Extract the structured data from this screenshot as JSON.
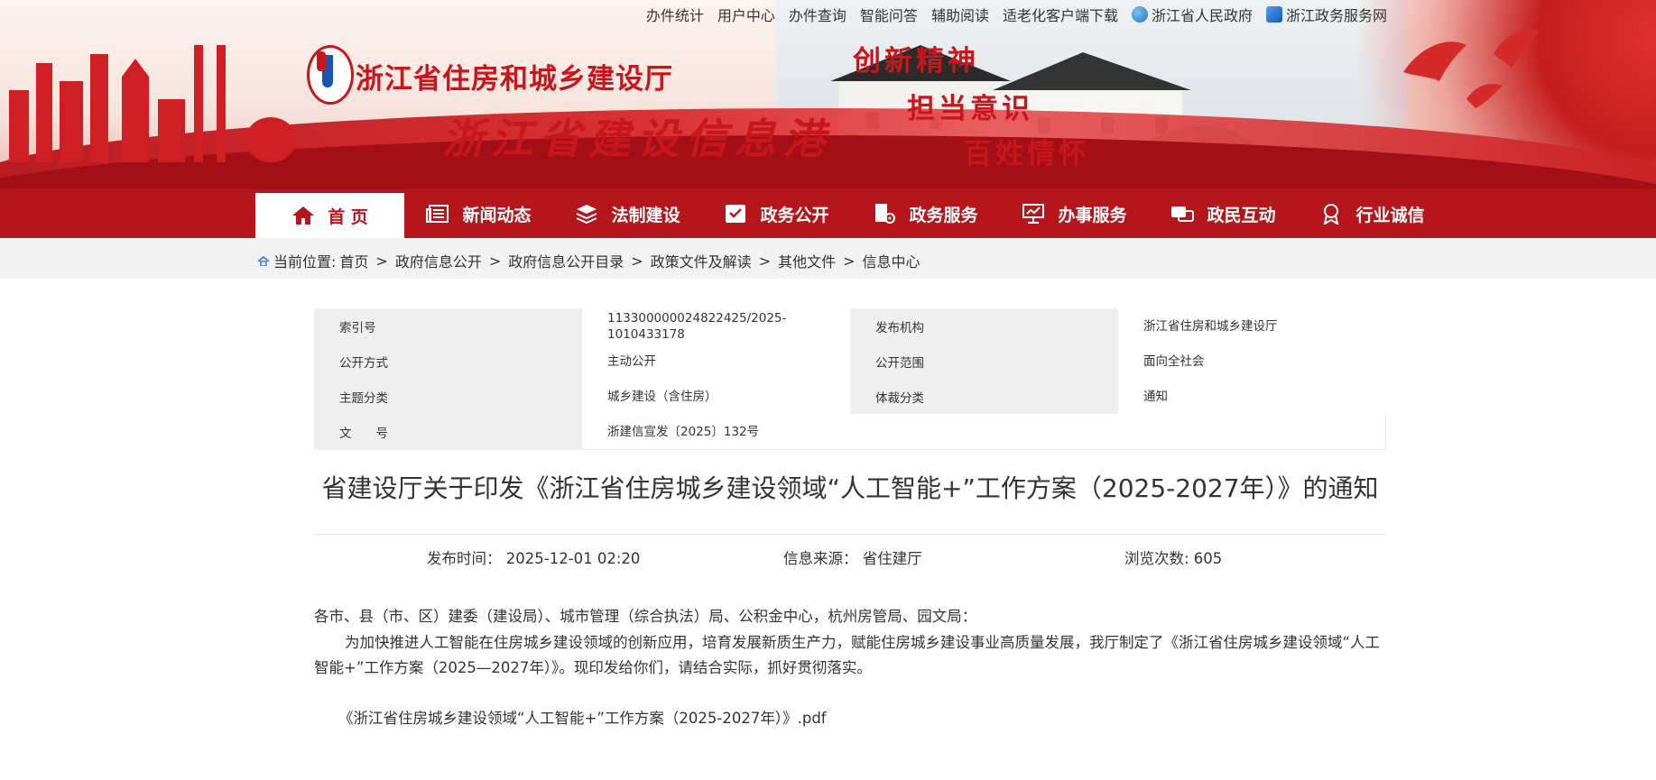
{
  "top_links": [
    "办件统计",
    "用户中心",
    "办件查询",
    "智能问答",
    "辅助阅读",
    "适老化客户端下载"
  ],
  "gov_links": [
    "浙江省人民政府",
    "浙江政务服务网"
  ],
  "banner": {
    "logo_text": "浙江省住房和城乡建设厅",
    "portal_title": "浙江省建设信息港",
    "slogans": [
      "创新精神",
      "担当意识",
      "百姓情怀"
    ]
  },
  "nav": {
    "items": [
      {
        "label": "首 页",
        "icon": "home-icon"
      },
      {
        "label": "新闻动态",
        "icon": "news-icon"
      },
      {
        "label": "法制建设",
        "icon": "layers-icon"
      },
      {
        "label": "政务公开",
        "icon": "checklist-icon"
      },
      {
        "label": "政务服务",
        "icon": "document-gear-icon"
      },
      {
        "label": "办事服务",
        "icon": "presentation-icon"
      },
      {
        "label": "政民互动",
        "icon": "chat-icon"
      },
      {
        "label": "行业诚信",
        "icon": "badge-icon"
      }
    ],
    "active": "首 页"
  },
  "breadcrumb": {
    "prefix": "当前位置:",
    "items": [
      "首页",
      "政府信息公开",
      "政府信息公开目录",
      "政策文件及解读",
      "其他文件",
      "信息中心"
    ]
  },
  "info": {
    "rows": [
      {
        "l1": "索引号",
        "v1": "113300000024822425/2025-1010433178",
        "l2": "发布机构",
        "v2": "浙江省住房和城乡建设厅"
      },
      {
        "l1": "公开方式",
        "v1": "主动公开",
        "l2": "公开范围",
        "v2": "面向全社会"
      },
      {
        "l1": "主题分类",
        "v1": "城乡建设（含住房）",
        "l2": "体裁分类",
        "v2": "通知"
      },
      {
        "l1": "文　　号",
        "v1": "浙建信宣发〔2025〕132号"
      }
    ]
  },
  "article": {
    "title": "省建设厅关于印发《浙江省住房城乡建设领域“人工智能+”工作方案（2025-2027年）》的通知",
    "publish_time": "发布时间：  2025-12-01 02:20",
    "source": "信息来源：  省住建厅",
    "views": "浏览次数: 605",
    "para1": "各市、县（市、区）建委（建设局）、城市管理（综合执法）局、公积金中心，杭州房管局、园文局：",
    "para2": "为加快推进人工智能在住房城乡建设领域的创新应用，培育发展新质生产力，赋能住房城乡建设事业高质量发展，我厅制定了《浙江省住房城乡建设领域“人工智能+”工作方案（2025—2027年）》。现印发给你们，请结合实际，抓好贯彻落实。",
    "attachment": "《浙江省住房城乡建设领域“人工智能+”工作方案（2025-2027年）》.pdf"
  }
}
